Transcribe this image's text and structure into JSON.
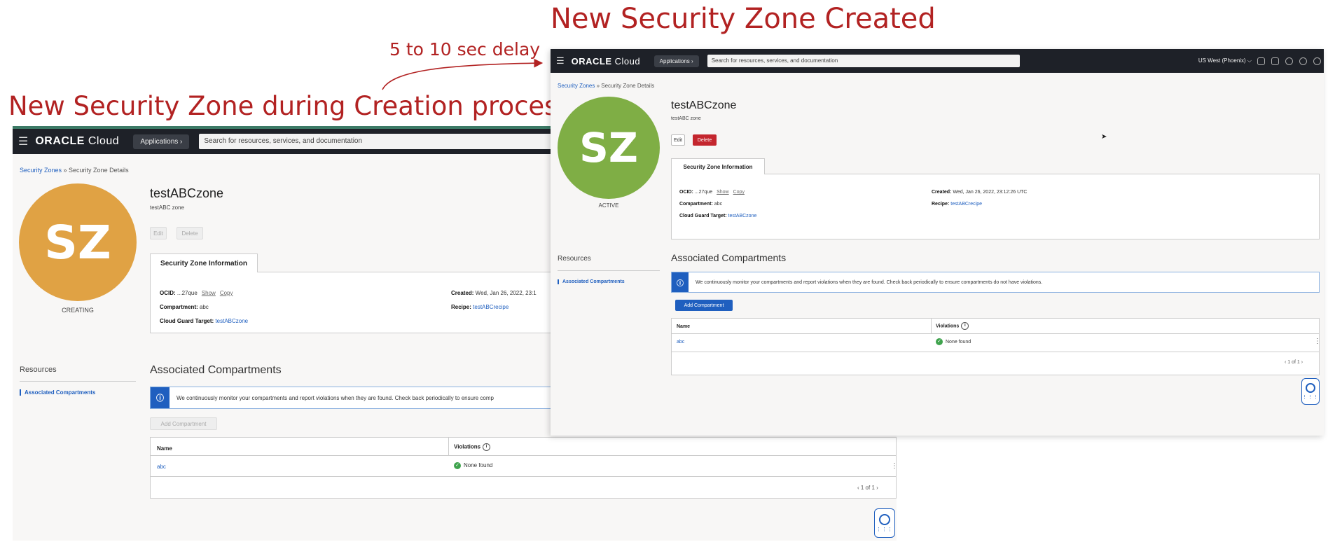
{
  "captions": {
    "creating": "New Security Zone during Creation process",
    "created": "New Security Zone Created",
    "delay": "5 to 10 sec delay"
  },
  "colors": {
    "caption": "#b22222",
    "avatar_creating": "#e0a244",
    "avatar_active": "#7fae45",
    "topbar": "#1e2128",
    "link": "#1f5fbf",
    "danger": "#c4262e"
  },
  "console": {
    "logo_main": "ORACLE",
    "logo_sub": " Cloud",
    "applications": "Applications ›",
    "search_placeholder": "Search for resources, services, and documentation",
    "region": "US West (Phoenix) ⌵"
  },
  "breadcrumb": {
    "root": "Security Zones",
    "sep": " » ",
    "current": "Security Zone Details"
  },
  "zone": {
    "avatar": "SZ",
    "name": "testABCzone",
    "description": "testABC zone",
    "status_creating": "CREATING",
    "status_active": "ACTIVE"
  },
  "buttons": {
    "edit": "Edit",
    "delete": "Delete",
    "add_compartment": "Add Compartment"
  },
  "info_tab": "Security Zone Information",
  "details": {
    "ocid_label": "OCID:",
    "ocid_value": " ...27que",
    "show": "Show",
    "copy": "Copy",
    "compartment_label": "Compartment:",
    "compartment_value": " abc",
    "target_label": "Cloud Guard Target:",
    "target_value": "testABCzone",
    "created_label": "Created:",
    "created_value_full": " Wed, Jan 26, 2022, 23:12:26 UTC",
    "created_value_cut": " Wed, Jan 26, 2022, 23:1",
    "recipe_label": "Recipe:",
    "recipe_value": "testABCrecipe"
  },
  "resources": {
    "header": "Resources",
    "item": "Associated Compartments"
  },
  "compartments": {
    "title": "Associated Compartments",
    "notice_full": "We continuously monitor your compartments and report violations when they are found. Check back periodically to ensure compartments do not have violations.",
    "notice_cut": "We continuously monitor your compartments and report violations when they are found. Check back periodically to ensure comp",
    "col_name": "Name",
    "col_violations": "Violations",
    "row_name": "abc",
    "row_violations": "None found",
    "pager": "‹  1 of 1  ›"
  }
}
